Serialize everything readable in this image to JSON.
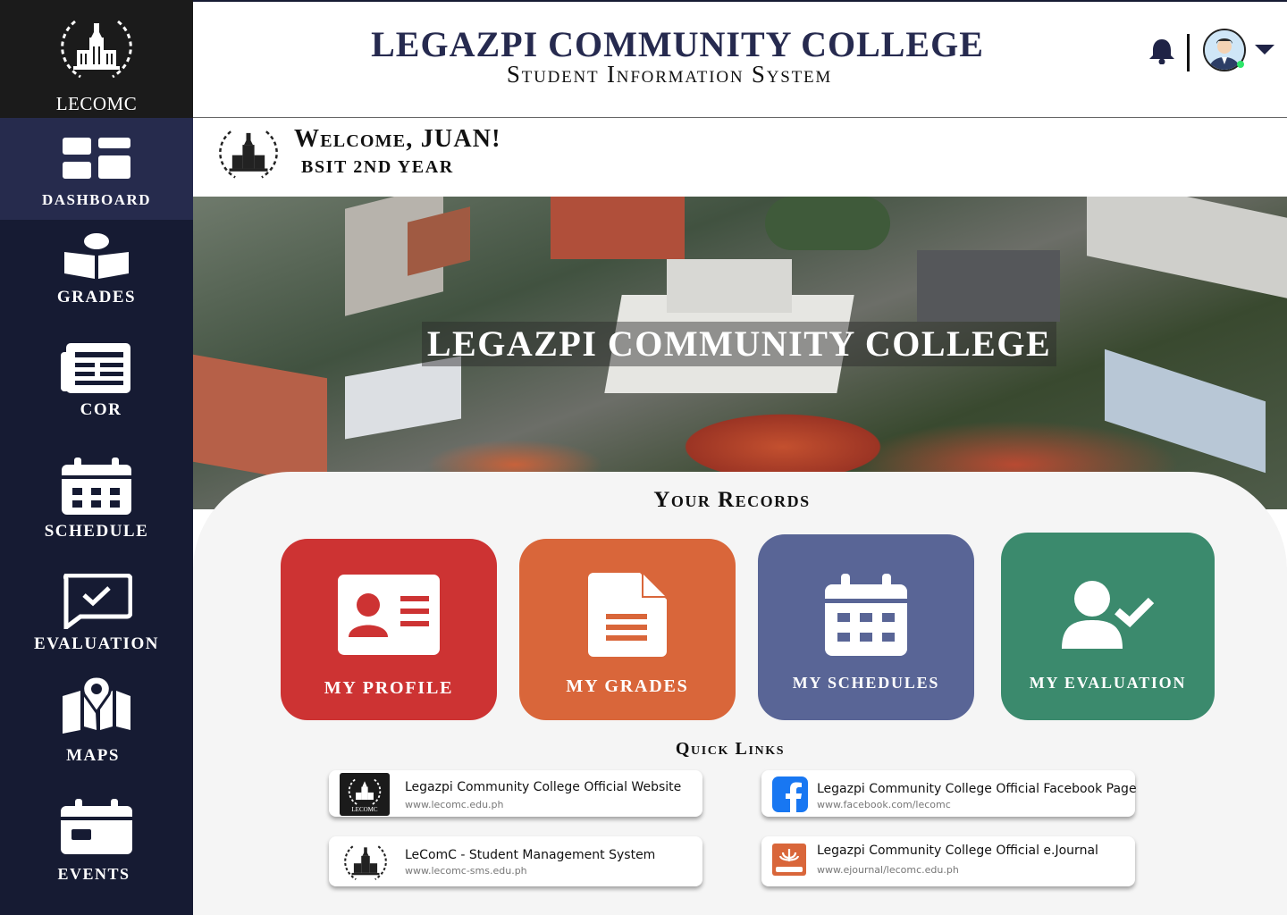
{
  "brand": {
    "label": "LECOMC"
  },
  "sidebar": {
    "items": [
      {
        "label": "DASHBOARD",
        "icon": "dashboard-icon",
        "active": true
      },
      {
        "label": "GRADES",
        "icon": "book-reader-icon"
      },
      {
        "label": "COR",
        "icon": "newspaper-icon"
      },
      {
        "label": "SCHEDULE",
        "icon": "calendar-icon"
      },
      {
        "label": "EVALUATION",
        "icon": "chat-check-icon"
      },
      {
        "label": "MAPS",
        "icon": "map-pin-icon"
      },
      {
        "label": "EVENTS",
        "icon": "event-calendar-icon"
      }
    ]
  },
  "header": {
    "title": "LEGAZPI COMMUNITY COLLEGE",
    "subtitle": "Student Information System",
    "notification_icon": "bell-icon",
    "profile_icon": "user-avatar-icon",
    "menu_icon": "chevron-down-icon"
  },
  "welcome": {
    "title": "Welcome, JUAN!",
    "subtitle": "BSIT 2ND YEAR"
  },
  "banner": {
    "title": "LEGAZPI COMMUNITY COLLEGE"
  },
  "records": {
    "title": "Your Records",
    "cards": [
      {
        "label": "MY PROFILE",
        "color": "#cd3333",
        "icon": "id-card-icon"
      },
      {
        "label": "MY GRADES",
        "color": "#d9663a",
        "icon": "document-icon"
      },
      {
        "label": "MY SCHEDULES",
        "color": "#596596",
        "icon": "calendar-icon"
      },
      {
        "label": "MY EVALUATION",
        "color": "#3b8a6d",
        "icon": "user-check-icon"
      }
    ]
  },
  "quick_links": {
    "title": "Quick Links",
    "items": [
      {
        "title": "Legazpi Community College Official Website",
        "url": "www.lecomc.edu.ph",
        "icon": "lecomc-logo-icon",
        "icon_label": "LECOMC"
      },
      {
        "title": "Legazpi Community College Official Facebook Page",
        "url": "www.facebook.com/lecomc",
        "icon": "facebook-icon"
      },
      {
        "title": "LeComC -  Student Management System",
        "url": "www.lecomc-sms.edu.ph",
        "icon": "college-seal-icon"
      },
      {
        "title": "Legazpi Community College Official e.Journal",
        "url": "www.ejournal/lecomc.edu.ph",
        "icon": "journal-icon"
      }
    ]
  },
  "colors": {
    "sidebar_bg": "#161b33",
    "sidebar_active": "#262b4d",
    "title_navy": "#262a4f",
    "panel_bg": "#f5f5f5"
  }
}
